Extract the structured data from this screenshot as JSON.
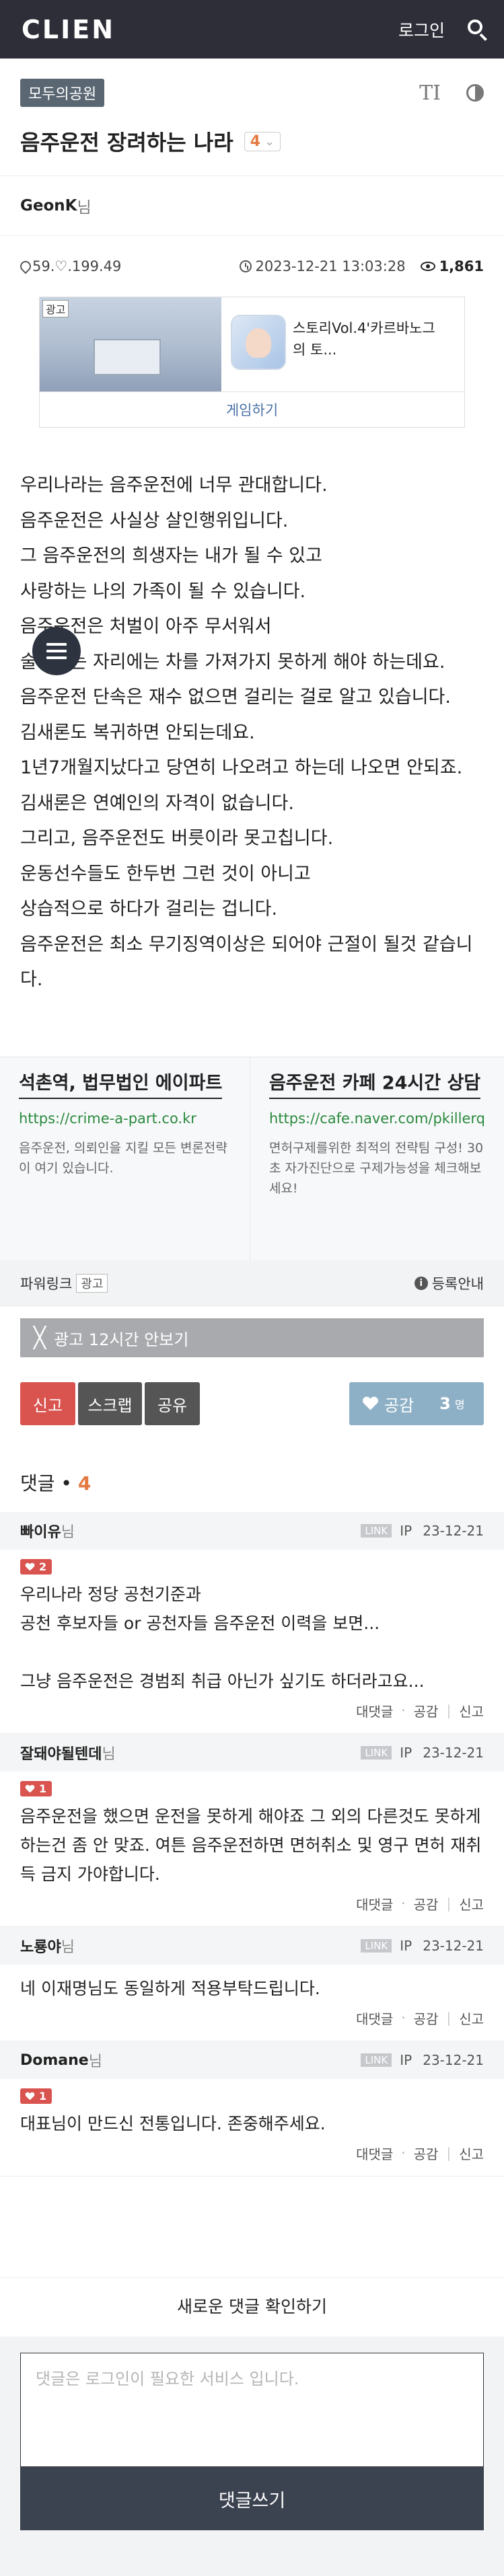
{
  "header": {
    "logo": "CLIEN",
    "login_label": "로그인"
  },
  "board": {
    "tag": "모두의공원",
    "font_icon_glyph": "TI"
  },
  "post": {
    "title": "음주운전 장려하는 나라",
    "comment_badge": "4",
    "author": "GeonK",
    "author_suffix": "님",
    "ip": "59.♡.199.49",
    "datetime": "2023-12-21 13:03:28",
    "views": "1,861",
    "body": [
      "우리나라는 음주운전에 너무 관대합니다.",
      "음주운전은 사실상 살인행위입니다.",
      "그 음주운전의 희생자는 내가 될 수 있고",
      "사랑하는 나의 가족이 될 수 있습니다.",
      "음주운전은 처벌이 아주 무서워서",
      "술마시는 자리에는 차를 가져가지 못하게 해야 하는데요.",
      "음주운전 단속은 재수 없으면 걸리는 걸로 알고 있습니다.",
      "김새론도 복귀하면 안되는데요.",
      "1년7개월지났다고 당연히 나오려고 하는데 나오면 안되죠.",
      "김새론은 연예인의 자격이 없습니다.",
      "그리고, 음주운전도 버릇이라 못고칩니다.",
      "운동선수들도 한두번 그런 것이 아니고",
      "상습적으로 하다가 걸리는 겁니다.",
      "음주운전은 최소 무기징역이상은 되어야 근절이 될것 같습니다."
    ]
  },
  "ad_card": {
    "label": "광고",
    "text": "스토리Vol.4'카르바노그의 토...",
    "cta": "게임하기"
  },
  "power_link": {
    "items": [
      {
        "title": "석촌역, 법무법인 에이파트",
        "url": "https://crime-a-part.co.kr",
        "desc": "음주운전, 의뢰인을 지킬 모든 변론전략이 여기 있습니다."
      },
      {
        "title": "음주운전 카페 24시간 상담",
        "url": "https://cafe.naver.com/pkillerq",
        "desc": "면허구제를위한 최적의 전략팀 구성! 30초 자가진단으로 구제가능성을 체크해보세요!"
      }
    ],
    "label": "파워링크",
    "badge": "광고",
    "register": "등록안내"
  },
  "hide_ad": {
    "label": "광고 12시간 안보기",
    "x": "╳"
  },
  "actions": {
    "report": "신고",
    "scrap": "스크랩",
    "share": "공유",
    "like": "공감",
    "like_count": "3",
    "like_unit": "명"
  },
  "comments_header": {
    "label": "댓글 • ",
    "count": "4"
  },
  "comments": [
    {
      "nick": "빠이유",
      "nim": "님",
      "link": "LINK",
      "ip": "IP",
      "date": "23-12-21",
      "likes": "2",
      "body": "우리나라 정당 공천기준과\n공천 후보자들 or 공천자들 음주운전 이력을 보면...\n\n그냥 음주운전은 경범죄 취급 아닌가 싶기도 하더라고요...",
      "reply": "대댓글",
      "dot": "·",
      "like": "공감",
      "report": "신고"
    },
    {
      "nick": "잘돼야될텐데",
      "nim": "님",
      "link": "LINK",
      "ip": "IP",
      "date": "23-12-21",
      "likes": "1",
      "body": "음주운전을 했으면 운전을 못하게 해야죠 그 외의 다른것도 못하게 하는건 좀 안 맞죠. 여튼 음주운전하면 면허취소 및 영구 면허 재취득 금지 가야합니다.",
      "reply": "대댓글",
      "dot": "·",
      "like": "공감",
      "report": "신고"
    },
    {
      "nick": "노룡야",
      "nim": "님",
      "link": "LINK",
      "ip": "IP",
      "date": "23-12-21",
      "likes": "",
      "body": "네 이재명님도 동일하게 적용부탁드립니다.",
      "reply": "대댓글",
      "dot": "·",
      "like": "공감",
      "report": "신고"
    },
    {
      "nick": "Domane",
      "nim": "님",
      "link": "LINK",
      "ip": "IP",
      "date": "23-12-21",
      "likes": "1",
      "body": "대표님이 만드신 전통입니다. 존중해주세요.",
      "reply": "대댓글",
      "dot": "·",
      "like": "공감",
      "report": "신고"
    }
  ],
  "new_comments_label": "새로운 댓글 확인하기",
  "write": {
    "placeholder": "댓글은 로그인이 필요한 서비스 입니다.",
    "submit": "댓글쓰기"
  }
}
